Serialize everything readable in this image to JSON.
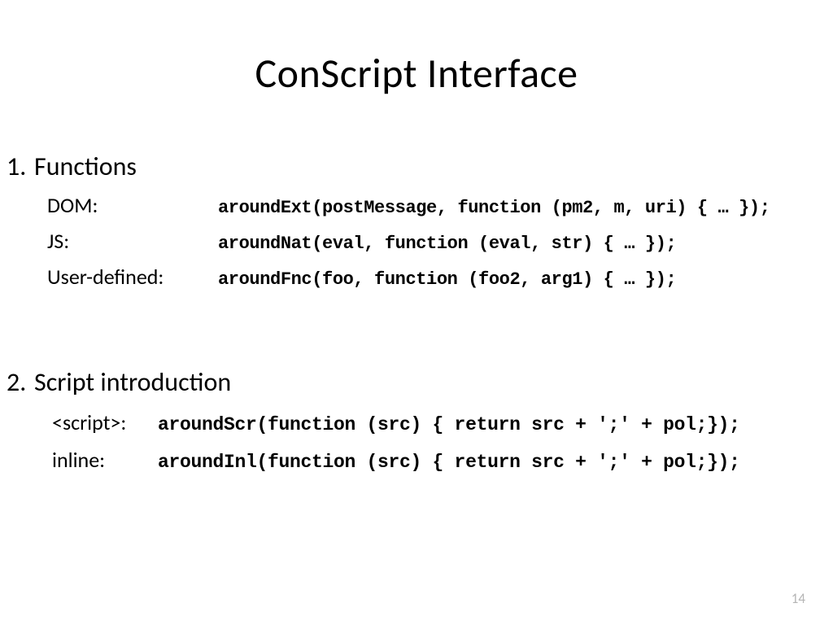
{
  "title": "ConScript Interface",
  "section1": {
    "number": "1.",
    "heading": "Functions",
    "items": [
      {
        "label": "DOM:",
        "code": "aroundExt(postMessage, function (pm2, m, uri) { … });"
      },
      {
        "label": "JS:",
        "code": "aroundNat(eval, function (eval, str) { … });"
      },
      {
        "label": "User-defined:",
        "code": "aroundFnc(foo, function (foo2, arg1) { … });"
      }
    ]
  },
  "section2": {
    "number": "2.",
    "heading": "Script introduction",
    "items": [
      {
        "label": "<script>:",
        "code": "aroundScr(function (src) { return src + ';' + pol;});"
      },
      {
        "label": "inline:",
        "code": "aroundInl(function (src) { return src + ';' + pol;});"
      }
    ]
  },
  "page_number": "14"
}
